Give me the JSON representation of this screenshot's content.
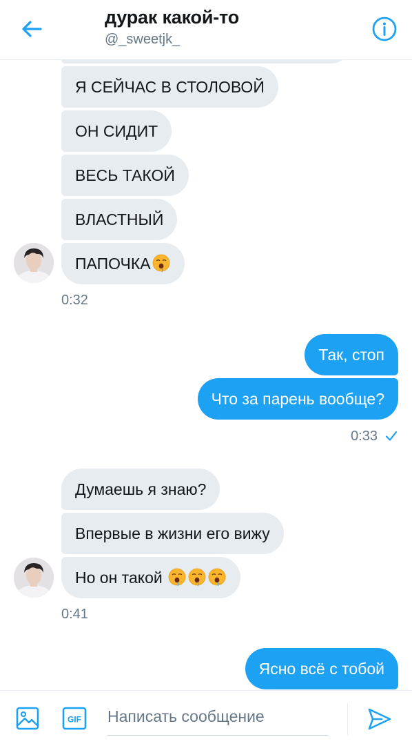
{
  "header": {
    "title": "дурак какой-то",
    "username": "@_sweetjk_"
  },
  "colors": {
    "accent": "#1da1f2",
    "incoming_bubble": "#e6ecf0",
    "secondary_text": "#657786"
  },
  "icons": {
    "back": "arrow-left-icon",
    "info": "info-icon",
    "image": "image-icon",
    "gif": "gif-icon",
    "send": "send-icon",
    "read": "checkmark-icon",
    "emoji": "drooling-face-emoji"
  },
  "conversation": {
    "group1": {
      "messages": [
        "Я СЕЙЧАС В СТОЛОВОЙ",
        "ОН СИДИТ",
        "ВЕСЬ ТАКОЙ",
        "ВЛАСТНЫЙ",
        "ПАПОЧКА"
      ],
      "time": "0:32"
    },
    "group2": {
      "messages": [
        "Так, стоп",
        "Что за парень вообще?"
      ],
      "time": "0:33"
    },
    "group3": {
      "messages": [
        "Думаешь я знаю?",
        "Впервые в жизни его вижу",
        "Но он такой"
      ],
      "time": "0:41"
    },
    "group4": {
      "messages": [
        "Ясно всё с тобой"
      ]
    }
  },
  "composer": {
    "placeholder": "Написать сообщение",
    "value": ""
  }
}
